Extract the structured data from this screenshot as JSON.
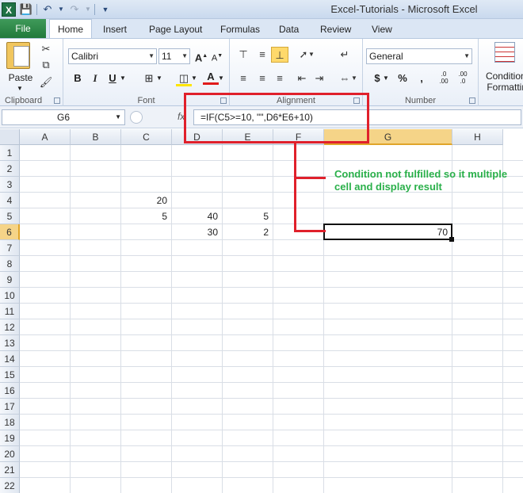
{
  "window": {
    "title": "Excel-Tutorials  -  Microsoft Excel",
    "app_icon": "X"
  },
  "quick_access": {
    "save": "save-icon",
    "undo": "undo-icon",
    "redo": "redo-icon",
    "customize": "customize-icon"
  },
  "tabs": [
    {
      "label": "File"
    },
    {
      "label": "Home"
    },
    {
      "label": "Insert"
    },
    {
      "label": "Page Layout"
    },
    {
      "label": "Formulas"
    },
    {
      "label": "Data"
    },
    {
      "label": "Review"
    },
    {
      "label": "View"
    }
  ],
  "ribbon": {
    "clipboard": {
      "label": "Clipboard",
      "paste_label": "Paste"
    },
    "font": {
      "label": "Font",
      "font_name": "Calibri",
      "font_size": "11",
      "bold": "B",
      "italic": "I",
      "underline": "U"
    },
    "alignment": {
      "label": "Alignment"
    },
    "number": {
      "label": "Number",
      "format": "General",
      "currency": "$",
      "percent": "%",
      "comma": ","
    },
    "styles": {
      "conditional_formatting": "Conditional Formatting"
    }
  },
  "formula_bar": {
    "name_box": "G6",
    "fx": "fx",
    "formula": "=IF(C5>=10, \"\",D6*E6+10)"
  },
  "grid": {
    "columns": [
      "A",
      "B",
      "C",
      "D",
      "E",
      "F",
      "G",
      "H"
    ],
    "rows": [
      "1",
      "2",
      "3",
      "4",
      "5",
      "6",
      "7",
      "8",
      "9",
      "10",
      "11",
      "12",
      "13",
      "14",
      "15",
      "16",
      "17",
      "18",
      "19",
      "20",
      "21",
      "22"
    ],
    "selected_column": "G",
    "selected_row": "6",
    "cells": {
      "C4": "20",
      "C5": "5",
      "D5": "40",
      "E5": "5",
      "D6": "30",
      "E6": "2",
      "G6": "70"
    }
  },
  "annotation": {
    "text": "Condition not fulfilled so it multiple cell and display result",
    "color": "#2ab04a",
    "box_color": "#e0202b"
  }
}
